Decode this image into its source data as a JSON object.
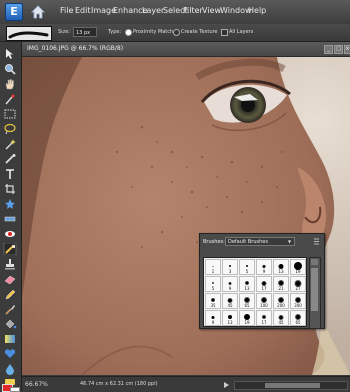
{
  "menu": [
    "File",
    "Edit",
    "Image",
    "Enhance",
    "Layer",
    "Select",
    "Filter",
    "View",
    "Window",
    "Help"
  ],
  "logo_text": "E",
  "options": {
    "size_label": "Size:",
    "size_value": "13 px",
    "type_label": "Type:",
    "proximity_label": "Proximity Match",
    "texture_label": "Create Texture",
    "all_layers_label": "All Layers"
  },
  "document": {
    "title": "IMG_0106.JPG @ 66.7% (RGB/8)",
    "zoom": "66.67%",
    "dimensions": "46.74 cm x 62.31 cm (180 ppi)"
  },
  "brush_picker": {
    "label": "Brushes:",
    "set": "Default Brushes",
    "brushes": [
      {
        "size": "1",
        "dot": 1,
        "soft": false
      },
      {
        "size": "3",
        "dot": 2,
        "soft": false
      },
      {
        "size": "5",
        "dot": 2,
        "soft": false
      },
      {
        "size": "9",
        "dot": 3,
        "soft": false
      },
      {
        "size": "13",
        "dot": 5,
        "soft": false
      },
      {
        "size": "19",
        "dot": 8,
        "soft": false
      },
      {
        "size": "5",
        "dot": 2,
        "soft": true
      },
      {
        "size": "9",
        "dot": 3,
        "soft": true
      },
      {
        "size": "13",
        "dot": 4,
        "soft": true
      },
      {
        "size": "17",
        "dot": 5,
        "soft": true
      },
      {
        "size": "21",
        "dot": 6,
        "soft": true
      },
      {
        "size": "27",
        "dot": 7,
        "soft": true
      },
      {
        "size": "35",
        "dot": 4,
        "soft": true
      },
      {
        "size": "45",
        "dot": 5,
        "soft": true
      },
      {
        "size": "65",
        "dot": 6,
        "soft": true
      },
      {
        "size": "100",
        "dot": 6,
        "soft": true
      },
      {
        "size": "200",
        "dot": 6,
        "soft": true
      },
      {
        "size": "300",
        "dot": 6,
        "soft": true
      },
      {
        "size": "9",
        "dot": 3,
        "soft": false
      },
      {
        "size": "13",
        "dot": 4,
        "soft": false
      },
      {
        "size": "19",
        "dot": 6,
        "soft": false
      },
      {
        "size": "17",
        "dot": 4,
        "soft": true
      },
      {
        "size": "45",
        "dot": 5,
        "soft": true
      },
      {
        "size": "65",
        "dot": 6,
        "soft": true
      }
    ]
  },
  "colors": {
    "foreground": "#e3262b",
    "background": "#ffffff"
  }
}
